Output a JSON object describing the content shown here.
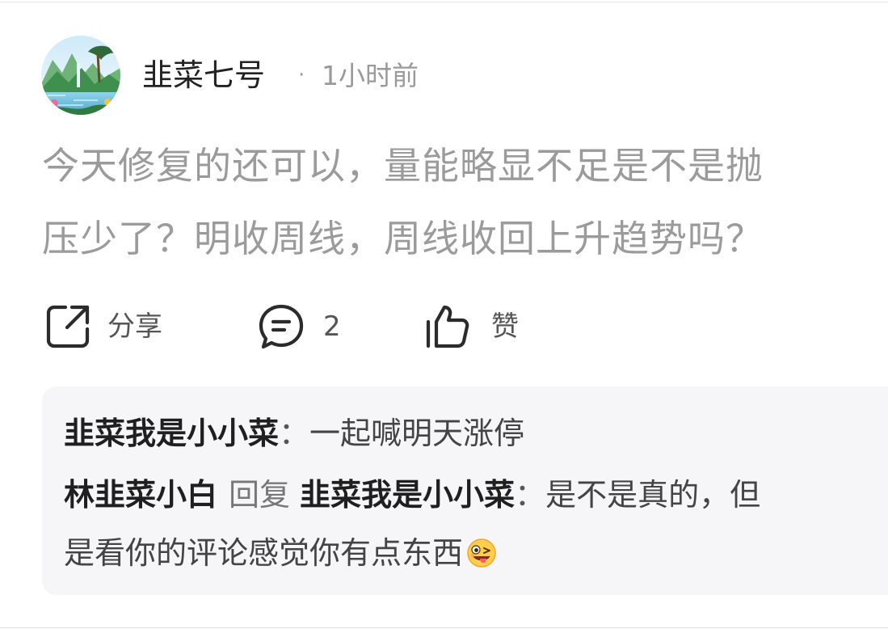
{
  "post": {
    "author": "韭菜七号",
    "meta_separator": "·",
    "timestamp": "1小时前",
    "content_line_1": "今天修复的还可以，量能略显不足是不是抛",
    "content_line_2": "压少了？明收周线，周线收回上升趋势吗？"
  },
  "actions": {
    "share_label": "分享",
    "comment_count": "2",
    "like_label": "赞"
  },
  "replies": [
    {
      "author": "韭菜我是小小菜",
      "separator": "：",
      "text": "一起喊明天涨停"
    },
    {
      "author": "林韭菜小白",
      "verb": "回复",
      "reply_to": "韭菜我是小小菜",
      "separator": "：",
      "text": "是不是真的，但",
      "text_continued": "是看你的评论感觉你有点东西",
      "emoji": "winking-face-with-tongue"
    }
  ],
  "icons": {
    "share": "share-icon",
    "comment": "comment-icon",
    "like": "thumbs-up-icon"
  },
  "colors": {
    "post_text": "#9b9b9b",
    "author_name": "#222222",
    "meta_text": "#9a9a9a",
    "reply_background": "#f6f6f8"
  }
}
